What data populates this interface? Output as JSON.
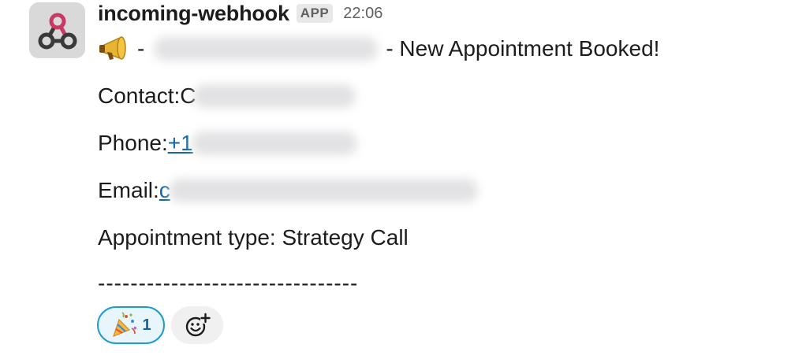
{
  "message": {
    "sender": "incoming-webhook",
    "badge": "APP",
    "timestamp": "22:06",
    "avatar_icon": "webhook-icon",
    "headline": {
      "emoji_icon": "megaphone-icon",
      "prefix": "-",
      "suffix": "- New Appointment Booked!"
    },
    "contact": {
      "label": "Contact: ",
      "visible_start": "C"
    },
    "phone": {
      "label": "Phone: ",
      "visible_start": "+1"
    },
    "email": {
      "label": "Email: ",
      "visible_start": "c"
    },
    "appointment": {
      "text": "Appointment type: Strategy Call"
    },
    "divider": "--------------------------------",
    "reactions": [
      {
        "icon": "party-popper-icon",
        "count": "1"
      }
    ],
    "add_reaction_icon": "add-emoji-icon"
  },
  "colors": {
    "link": "#1264a3",
    "reaction_border": "#1d9bd1",
    "reaction_bg": "#e8f5fa",
    "avatar_bg": "#d9d9d9",
    "webhook_pink": "#c83966"
  }
}
